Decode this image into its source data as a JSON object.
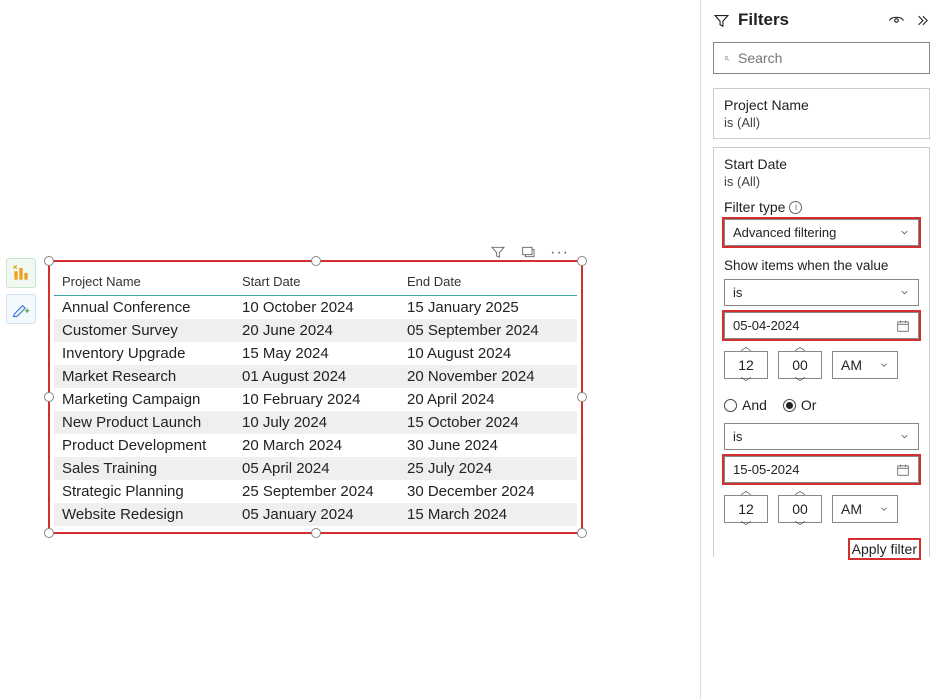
{
  "table": {
    "headers": [
      "Project Name",
      "Start Date",
      "End Date"
    ],
    "rows": [
      [
        "Annual Conference",
        "10 October 2024",
        "15 January 2025"
      ],
      [
        "Customer Survey",
        "20 June 2024",
        "05 September 2024"
      ],
      [
        "Inventory Upgrade",
        "15 May 2024",
        "10 August 2024"
      ],
      [
        "Market Research",
        "01 August 2024",
        "20 November 2024"
      ],
      [
        "Marketing Campaign",
        "10 February 2024",
        "20 April 2024"
      ],
      [
        "New Product Launch",
        "10 July 2024",
        "15 October 2024"
      ],
      [
        "Product Development",
        "20 March 2024",
        "30 June 2024"
      ],
      [
        "Sales Training",
        "05 April 2024",
        "25 July 2024"
      ],
      [
        "Strategic Planning",
        "25 September 2024",
        "30 December 2024"
      ],
      [
        "Website Redesign",
        "05 January 2024",
        "15 March 2024"
      ]
    ]
  },
  "filters": {
    "title": "Filters",
    "search_placeholder": "Search",
    "cards": [
      {
        "name": "Project Name",
        "value": "is (All)"
      },
      {
        "name": "Start Date",
        "value": "is (All)"
      }
    ],
    "filter_type_label": "Filter type",
    "filter_type_value": "Advanced filtering",
    "show_label": "Show items when the value",
    "cond1": {
      "op": "is",
      "date": "05-04-2024",
      "hh": "12",
      "mm": "00",
      "ampm": "AM"
    },
    "logic": {
      "and": "And",
      "or": "Or",
      "selected": "or"
    },
    "cond2": {
      "op": "is",
      "date": "15-05-2024",
      "hh": "12",
      "mm": "00",
      "ampm": "AM"
    },
    "apply_label": "Apply filter"
  }
}
